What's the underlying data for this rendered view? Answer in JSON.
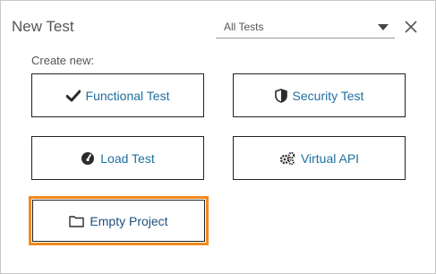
{
  "dialog": {
    "title": "New Test",
    "filter": {
      "selected": "All Tests"
    },
    "close_icon": "close-icon"
  },
  "create": {
    "label": "Create new:",
    "tiles": [
      {
        "label": "Functional Test",
        "icon": "checkmark-icon"
      },
      {
        "label": "Security Test",
        "icon": "shield-icon"
      },
      {
        "label": "Load Test",
        "icon": "gauge-icon"
      },
      {
        "label": "Virtual API",
        "icon": "gears-icon"
      },
      {
        "label": "Empty Project",
        "icon": "folder-icon",
        "selected": true
      }
    ]
  },
  "colors": {
    "tile_text": "#1f6f9f",
    "selection_border": "#f28a1e",
    "title_text": "#555555"
  }
}
